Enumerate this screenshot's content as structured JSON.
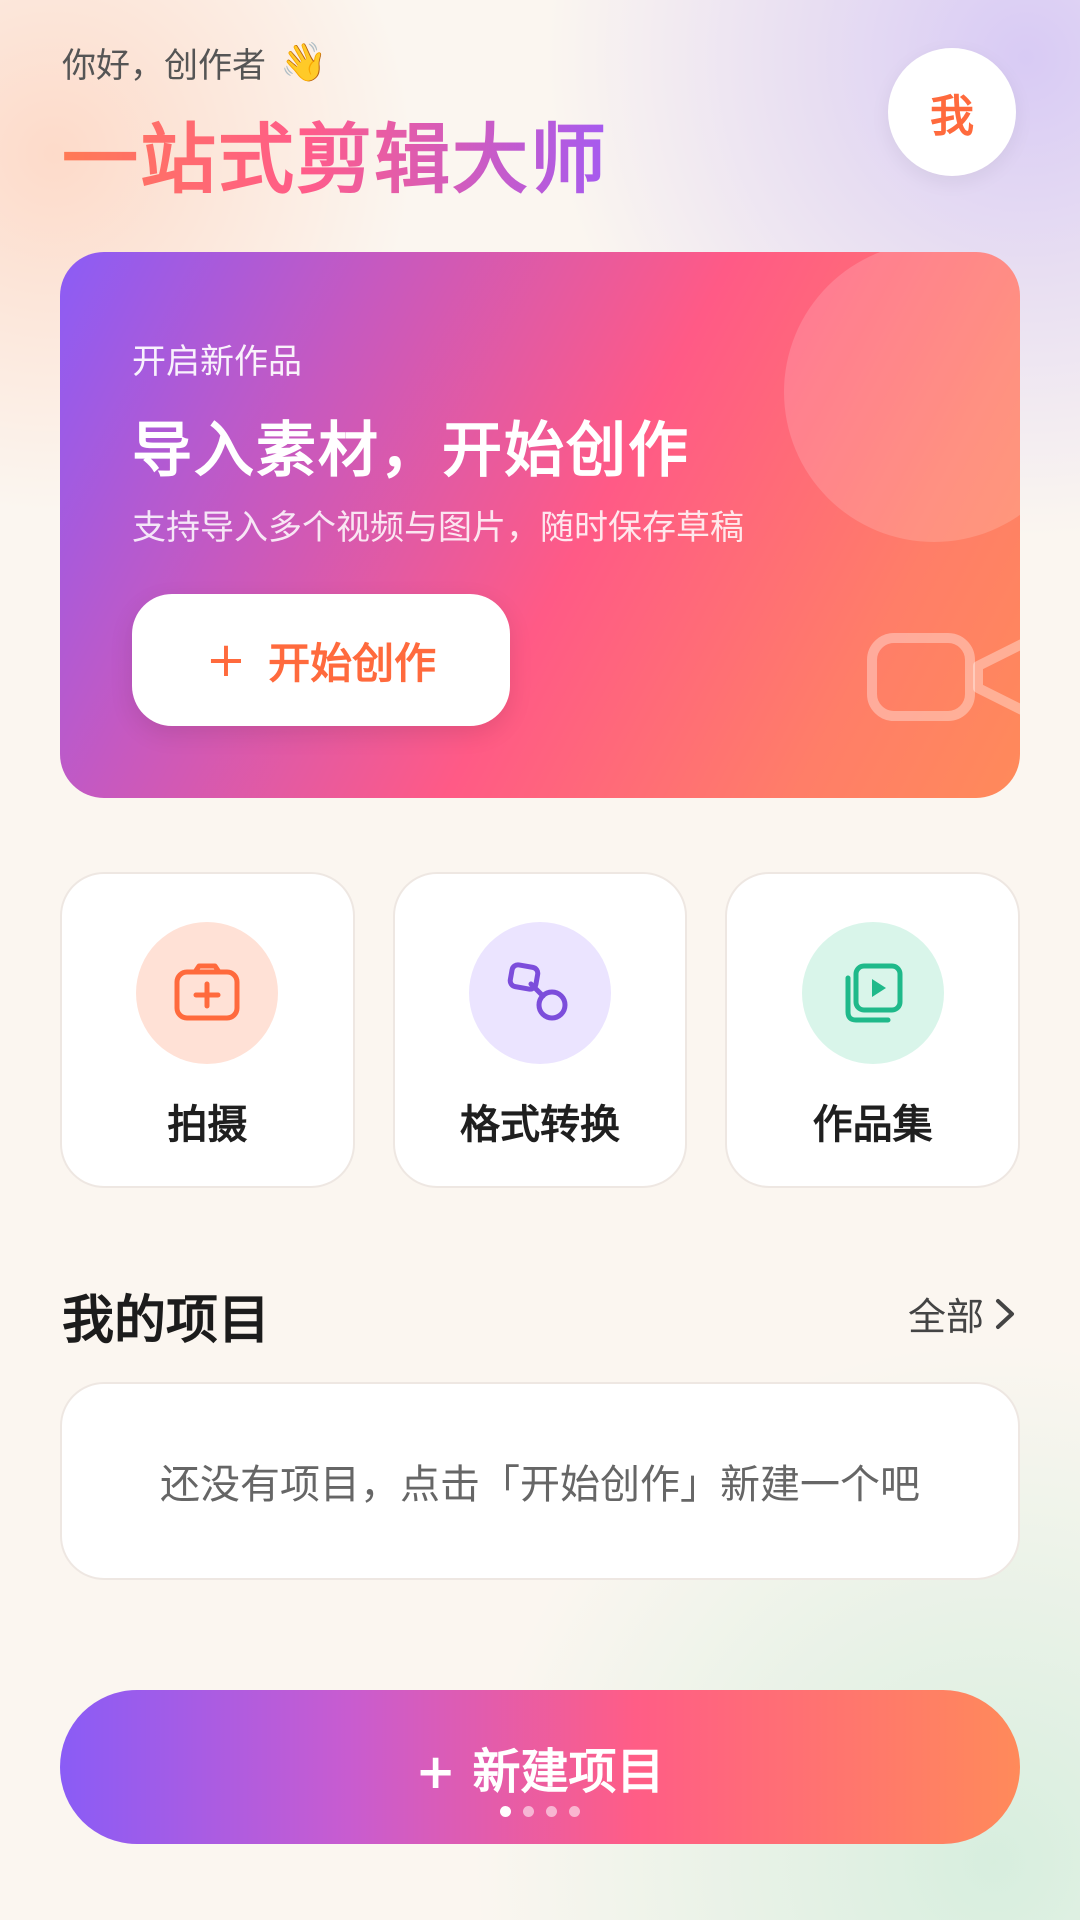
{
  "header": {
    "greeting": "你好，创作者",
    "wave_emoji": "👋",
    "app_title": "一站式剪辑大师",
    "avatar_label": "我"
  },
  "hero": {
    "subtitle": "开启新作品",
    "title": "导入素材，开始创作",
    "description": "支持导入多个视频与图片，随时保存草稿",
    "button_icon": "+",
    "button_label": "开始创作",
    "decor_icon": "video-camera-icon"
  },
  "quick_actions": [
    {
      "label": "拍摄",
      "icon": "camera-plus-icon",
      "icon_bg": "#ffe1d6",
      "icon_color": "#ff6a3d"
    },
    {
      "label": "格式转换",
      "icon": "convert-link-icon",
      "icon_bg": "#ebe4ff",
      "icon_color": "#7c4ddb"
    },
    {
      "label": "作品集",
      "icon": "media-library-icon",
      "icon_bg": "#d9f5ea",
      "icon_color": "#1fb98a"
    }
  ],
  "projects": {
    "section_title": "我的项目",
    "more_label": "全部",
    "empty_text": "还没有项目，点击「开始创作」新建一个吧"
  },
  "bottom": {
    "new_project_label": "+ 新建项目",
    "page_dots": 4,
    "active_dot": 1
  },
  "colors": {
    "accent_orange": "#ff6a3d",
    "accent_purple": "#8b5cf6",
    "accent_pink": "#ff5a86"
  }
}
